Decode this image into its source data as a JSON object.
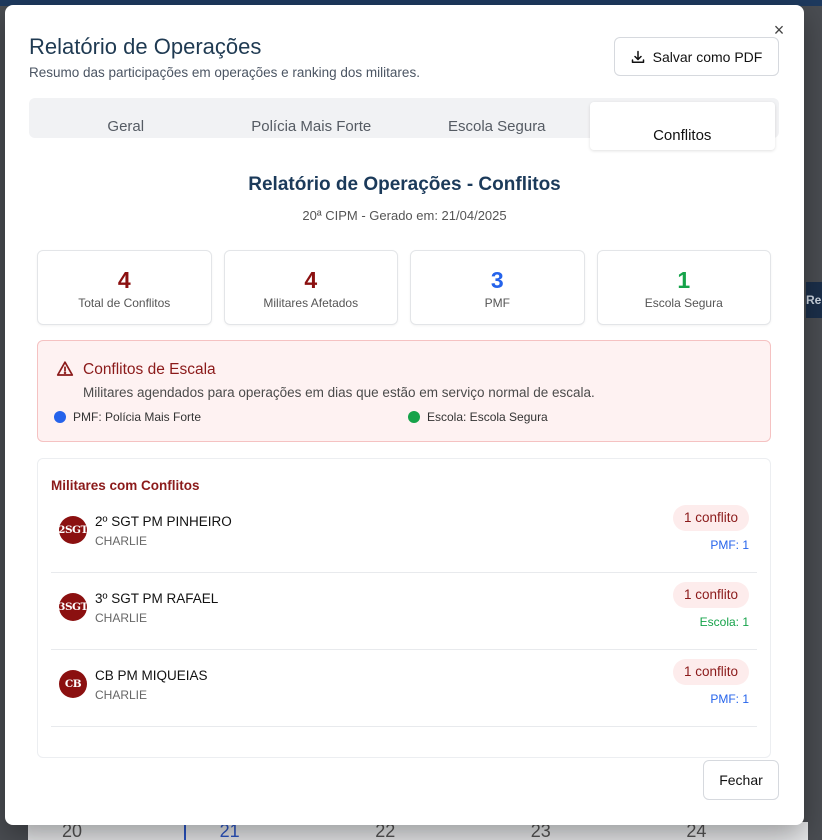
{
  "modal": {
    "title": "Relatório de Operações",
    "subtitle": "Resumo das participações em operações e ranking dos militares.",
    "close_glyph": "×",
    "pdf_button_label": "Salvar como PDF",
    "close_button_label": "Fechar"
  },
  "tabs": [
    {
      "label": "Geral",
      "active": false
    },
    {
      "label": "Polícia Mais Forte",
      "active": false
    },
    {
      "label": "Escola Segura",
      "active": false
    },
    {
      "label": "Conflitos",
      "active": true
    }
  ],
  "report": {
    "title": "Relatório de Operações - Conflitos",
    "subtitle": "20ª CIPM - Gerado em: 21/04/2025"
  },
  "stats": [
    {
      "value": "4",
      "label": "Total de Conflitos",
      "color": "#8b1010"
    },
    {
      "value": "4",
      "label": "Militares Afetados",
      "color": "#8b1010"
    },
    {
      "value": "3",
      "label": "PMF",
      "color": "#2563eb"
    },
    {
      "value": "1",
      "label": "Escola Segura",
      "color": "#16a34a"
    }
  ],
  "alert": {
    "title": "Conflitos de Escala",
    "description": "Militares agendados para operações em dias que estão em serviço normal de escala.",
    "legend": [
      {
        "label": "PMF: Polícia Mais Forte",
        "color": "#2563eb"
      },
      {
        "label": "Escola: Escola Segura",
        "color": "#16a34a"
      }
    ]
  },
  "conflicts_list": {
    "header": "Militares com Conflitos",
    "rows": [
      {
        "initials": "2SGT",
        "name": "2º SGT PM PINHEIRO",
        "unit": "CHARLIE",
        "badge": "1 conflito",
        "type": "PMF: 1",
        "type_color": "#2563eb"
      },
      {
        "initials": "3SGT",
        "name": "3º SGT PM RAFAEL",
        "unit": "CHARLIE",
        "badge": "1 conflito",
        "type": "Escola: 1",
        "type_color": "#16a34a"
      },
      {
        "initials": "CB",
        "name": "CB PM MIQUEIAS",
        "unit": "CHARLIE",
        "badge": "1 conflito",
        "type": "PMF: 1",
        "type_color": "#2563eb"
      }
    ]
  },
  "backdrop": {
    "side_tab_text": "Relato",
    "calendar_days": [
      "20",
      "21",
      "22",
      "23",
      "24"
    ]
  },
  "icons": {
    "close": "close-icon",
    "download": "download-icon",
    "alert": "alert-triangle-icon"
  }
}
